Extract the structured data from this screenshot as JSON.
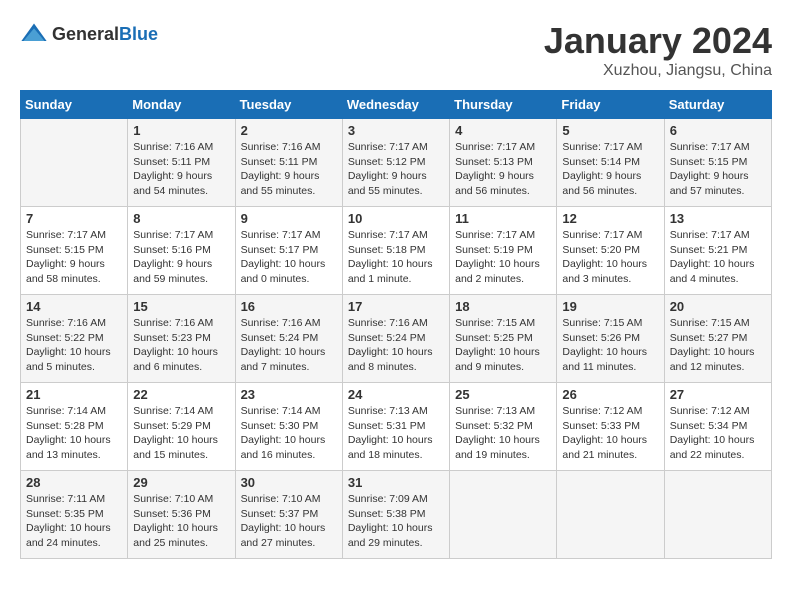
{
  "logo": {
    "general": "General",
    "blue": "Blue"
  },
  "title": "January 2024",
  "location": "Xuzhou, Jiangsu, China",
  "days_header": [
    "Sunday",
    "Monday",
    "Tuesday",
    "Wednesday",
    "Thursday",
    "Friday",
    "Saturday"
  ],
  "weeks": [
    [
      {
        "day": "",
        "info": ""
      },
      {
        "day": "1",
        "info": "Sunrise: 7:16 AM\nSunset: 5:11 PM\nDaylight: 9 hours\nand 54 minutes."
      },
      {
        "day": "2",
        "info": "Sunrise: 7:16 AM\nSunset: 5:11 PM\nDaylight: 9 hours\nand 55 minutes."
      },
      {
        "day": "3",
        "info": "Sunrise: 7:17 AM\nSunset: 5:12 PM\nDaylight: 9 hours\nand 55 minutes."
      },
      {
        "day": "4",
        "info": "Sunrise: 7:17 AM\nSunset: 5:13 PM\nDaylight: 9 hours\nand 56 minutes."
      },
      {
        "day": "5",
        "info": "Sunrise: 7:17 AM\nSunset: 5:14 PM\nDaylight: 9 hours\nand 56 minutes."
      },
      {
        "day": "6",
        "info": "Sunrise: 7:17 AM\nSunset: 5:15 PM\nDaylight: 9 hours\nand 57 minutes."
      }
    ],
    [
      {
        "day": "7",
        "info": "Sunrise: 7:17 AM\nSunset: 5:15 PM\nDaylight: 9 hours\nand 58 minutes."
      },
      {
        "day": "8",
        "info": "Sunrise: 7:17 AM\nSunset: 5:16 PM\nDaylight: 9 hours\nand 59 minutes."
      },
      {
        "day": "9",
        "info": "Sunrise: 7:17 AM\nSunset: 5:17 PM\nDaylight: 10 hours\nand 0 minutes."
      },
      {
        "day": "10",
        "info": "Sunrise: 7:17 AM\nSunset: 5:18 PM\nDaylight: 10 hours\nand 1 minute."
      },
      {
        "day": "11",
        "info": "Sunrise: 7:17 AM\nSunset: 5:19 PM\nDaylight: 10 hours\nand 2 minutes."
      },
      {
        "day": "12",
        "info": "Sunrise: 7:17 AM\nSunset: 5:20 PM\nDaylight: 10 hours\nand 3 minutes."
      },
      {
        "day": "13",
        "info": "Sunrise: 7:17 AM\nSunset: 5:21 PM\nDaylight: 10 hours\nand 4 minutes."
      }
    ],
    [
      {
        "day": "14",
        "info": "Sunrise: 7:16 AM\nSunset: 5:22 PM\nDaylight: 10 hours\nand 5 minutes."
      },
      {
        "day": "15",
        "info": "Sunrise: 7:16 AM\nSunset: 5:23 PM\nDaylight: 10 hours\nand 6 minutes."
      },
      {
        "day": "16",
        "info": "Sunrise: 7:16 AM\nSunset: 5:24 PM\nDaylight: 10 hours\nand 7 minutes."
      },
      {
        "day": "17",
        "info": "Sunrise: 7:16 AM\nSunset: 5:24 PM\nDaylight: 10 hours\nand 8 minutes."
      },
      {
        "day": "18",
        "info": "Sunrise: 7:15 AM\nSunset: 5:25 PM\nDaylight: 10 hours\nand 9 minutes."
      },
      {
        "day": "19",
        "info": "Sunrise: 7:15 AM\nSunset: 5:26 PM\nDaylight: 10 hours\nand 11 minutes."
      },
      {
        "day": "20",
        "info": "Sunrise: 7:15 AM\nSunset: 5:27 PM\nDaylight: 10 hours\nand 12 minutes."
      }
    ],
    [
      {
        "day": "21",
        "info": "Sunrise: 7:14 AM\nSunset: 5:28 PM\nDaylight: 10 hours\nand 13 minutes."
      },
      {
        "day": "22",
        "info": "Sunrise: 7:14 AM\nSunset: 5:29 PM\nDaylight: 10 hours\nand 15 minutes."
      },
      {
        "day": "23",
        "info": "Sunrise: 7:14 AM\nSunset: 5:30 PM\nDaylight: 10 hours\nand 16 minutes."
      },
      {
        "day": "24",
        "info": "Sunrise: 7:13 AM\nSunset: 5:31 PM\nDaylight: 10 hours\nand 18 minutes."
      },
      {
        "day": "25",
        "info": "Sunrise: 7:13 AM\nSunset: 5:32 PM\nDaylight: 10 hours\nand 19 minutes."
      },
      {
        "day": "26",
        "info": "Sunrise: 7:12 AM\nSunset: 5:33 PM\nDaylight: 10 hours\nand 21 minutes."
      },
      {
        "day": "27",
        "info": "Sunrise: 7:12 AM\nSunset: 5:34 PM\nDaylight: 10 hours\nand 22 minutes."
      }
    ],
    [
      {
        "day": "28",
        "info": "Sunrise: 7:11 AM\nSunset: 5:35 PM\nDaylight: 10 hours\nand 24 minutes."
      },
      {
        "day": "29",
        "info": "Sunrise: 7:10 AM\nSunset: 5:36 PM\nDaylight: 10 hours\nand 25 minutes."
      },
      {
        "day": "30",
        "info": "Sunrise: 7:10 AM\nSunset: 5:37 PM\nDaylight: 10 hours\nand 27 minutes."
      },
      {
        "day": "31",
        "info": "Sunrise: 7:09 AM\nSunset: 5:38 PM\nDaylight: 10 hours\nand 29 minutes."
      },
      {
        "day": "",
        "info": ""
      },
      {
        "day": "",
        "info": ""
      },
      {
        "day": "",
        "info": ""
      }
    ]
  ]
}
